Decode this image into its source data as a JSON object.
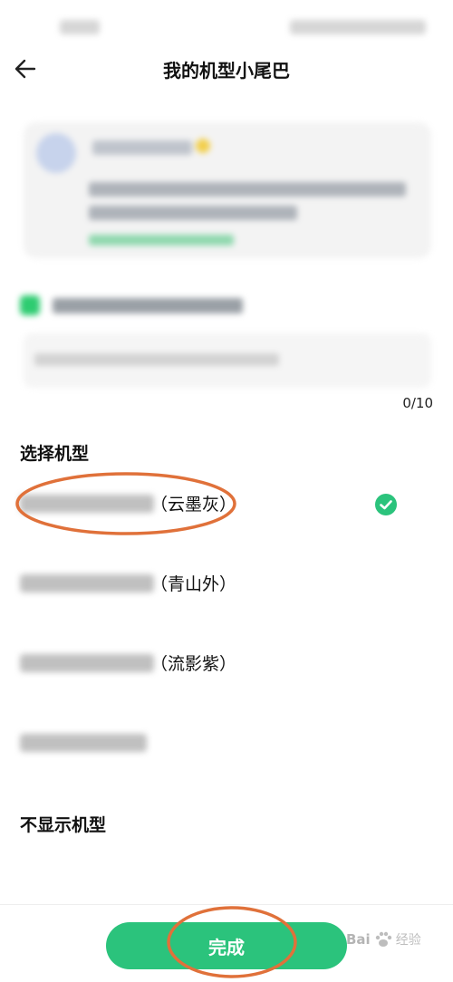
{
  "header": {
    "title": "我的机型小尾巴"
  },
  "editor": {
    "char_count": "0/10"
  },
  "models": {
    "section_title": "选择机型",
    "items": [
      {
        "suffix": "（云墨灰）",
        "selected": true
      },
      {
        "suffix": "（青山外）",
        "selected": false
      },
      {
        "suffix": "（流影紫）",
        "selected": false
      },
      {
        "suffix": "",
        "selected": false
      }
    ],
    "hide_label": "不显示机型"
  },
  "footer": {
    "done_label": "完成"
  },
  "watermark": {
    "brand": "Bai",
    "suffix": "经验"
  },
  "colors": {
    "accent": "#2bc37c",
    "annotation": "#e0713a"
  }
}
